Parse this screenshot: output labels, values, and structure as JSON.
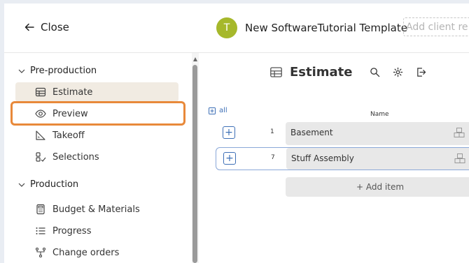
{
  "topbar": {
    "close_label": "Close",
    "avatar_initial": "T",
    "project_title": "New SoftwareTutorial Template",
    "client_ref_placeholder": "Add client re"
  },
  "sidebar": {
    "preproduction_label": "Pre-production",
    "production_label": "Production",
    "items": [
      {
        "label": "Estimate"
      },
      {
        "label": "Preview"
      },
      {
        "label": "Takeoff"
      },
      {
        "label": "Selections"
      },
      {
        "label": "Budget & Materials"
      },
      {
        "label": "Progress"
      },
      {
        "label": "Change orders"
      }
    ]
  },
  "main": {
    "title": "Estimate",
    "all_label": "all",
    "name_column": "Name",
    "rows": [
      {
        "num": "1",
        "name": "Basement"
      },
      {
        "num": "7",
        "name": "Stuff Assembly"
      }
    ],
    "add_item_label": "+ Add item"
  },
  "colors": {
    "accent": "#e8893a",
    "avatar": "#a6b82b",
    "link": "#3d6fb6",
    "active_bg": "#f1ebe2"
  }
}
